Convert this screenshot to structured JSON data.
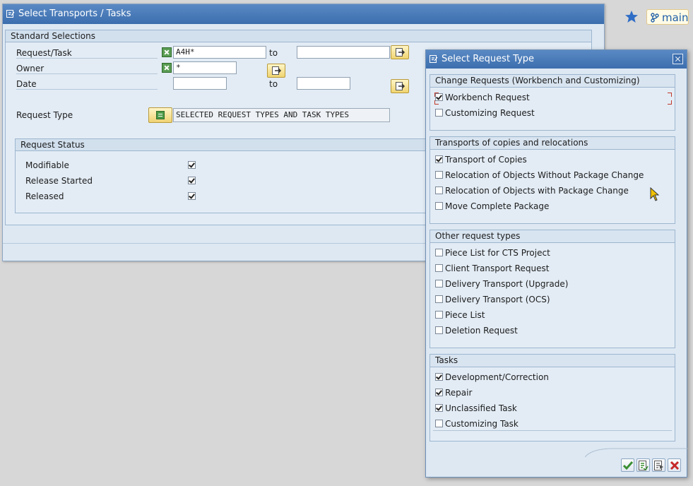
{
  "browser": {
    "branch_label": "main"
  },
  "main_window": {
    "title": "Select Transports / Tasks",
    "standard_selections": {
      "heading": "Standard Selections",
      "request_task": {
        "label": "Request/Task",
        "from_value": "A4H*",
        "to_label": "to",
        "to_value": ""
      },
      "owner": {
        "label": "Owner",
        "value": "*"
      },
      "date": {
        "label": "Date",
        "from_value": "",
        "to_label": "to",
        "to_value": ""
      },
      "request_type": {
        "label": "Request Type",
        "value": "SELECTED REQUEST TYPES AND TASK TYPES"
      },
      "request_status": {
        "heading": "Request Status",
        "items": [
          {
            "label": "Modifiable",
            "checked": true
          },
          {
            "label": "Release Started",
            "checked": true
          },
          {
            "label": "Released",
            "checked": true
          }
        ]
      }
    }
  },
  "dialog": {
    "title": "Select Request Type",
    "groups": [
      {
        "heading": "Change Requests (Workbench and Customizing)",
        "items": [
          {
            "label": "Workbench Request",
            "checked": true
          },
          {
            "label": "Customizing Request",
            "checked": false
          }
        ]
      },
      {
        "heading": "Transports of copies and relocations",
        "items": [
          {
            "label": "Transport of Copies",
            "checked": true
          },
          {
            "label": "Relocation of Objects Without Package Change",
            "checked": false
          },
          {
            "label": "Relocation of Objects with Package Change",
            "checked": false
          },
          {
            "label": "Move Complete Package",
            "checked": false
          }
        ]
      },
      {
        "heading": "Other request types",
        "items": [
          {
            "label": "Piece List for CTS Project",
            "checked": false
          },
          {
            "label": "Client Transport Request",
            "checked": false
          },
          {
            "label": "Delivery Transport (Upgrade)",
            "checked": false
          },
          {
            "label": "Delivery Transport (OCS)",
            "checked": false
          },
          {
            "label": "Piece List",
            "checked": false
          },
          {
            "label": "Deletion Request",
            "checked": false
          }
        ]
      },
      {
        "heading": "Tasks",
        "items": [
          {
            "label": "Development/Correction",
            "checked": true
          },
          {
            "label": "Repair",
            "checked": true
          },
          {
            "label": "Unclassified Task",
            "checked": true
          },
          {
            "label": "Customizing Task",
            "checked": false
          }
        ]
      }
    ],
    "footer_buttons": [
      "confirm-icon",
      "select-all-icon",
      "deselect-all-icon",
      "cancel-icon"
    ]
  },
  "colors": {
    "titlebar": "#3c6eae",
    "accent_yellow": "#f0d470",
    "confirm_green": "#4d9a46",
    "cancel_red": "#c62828"
  }
}
